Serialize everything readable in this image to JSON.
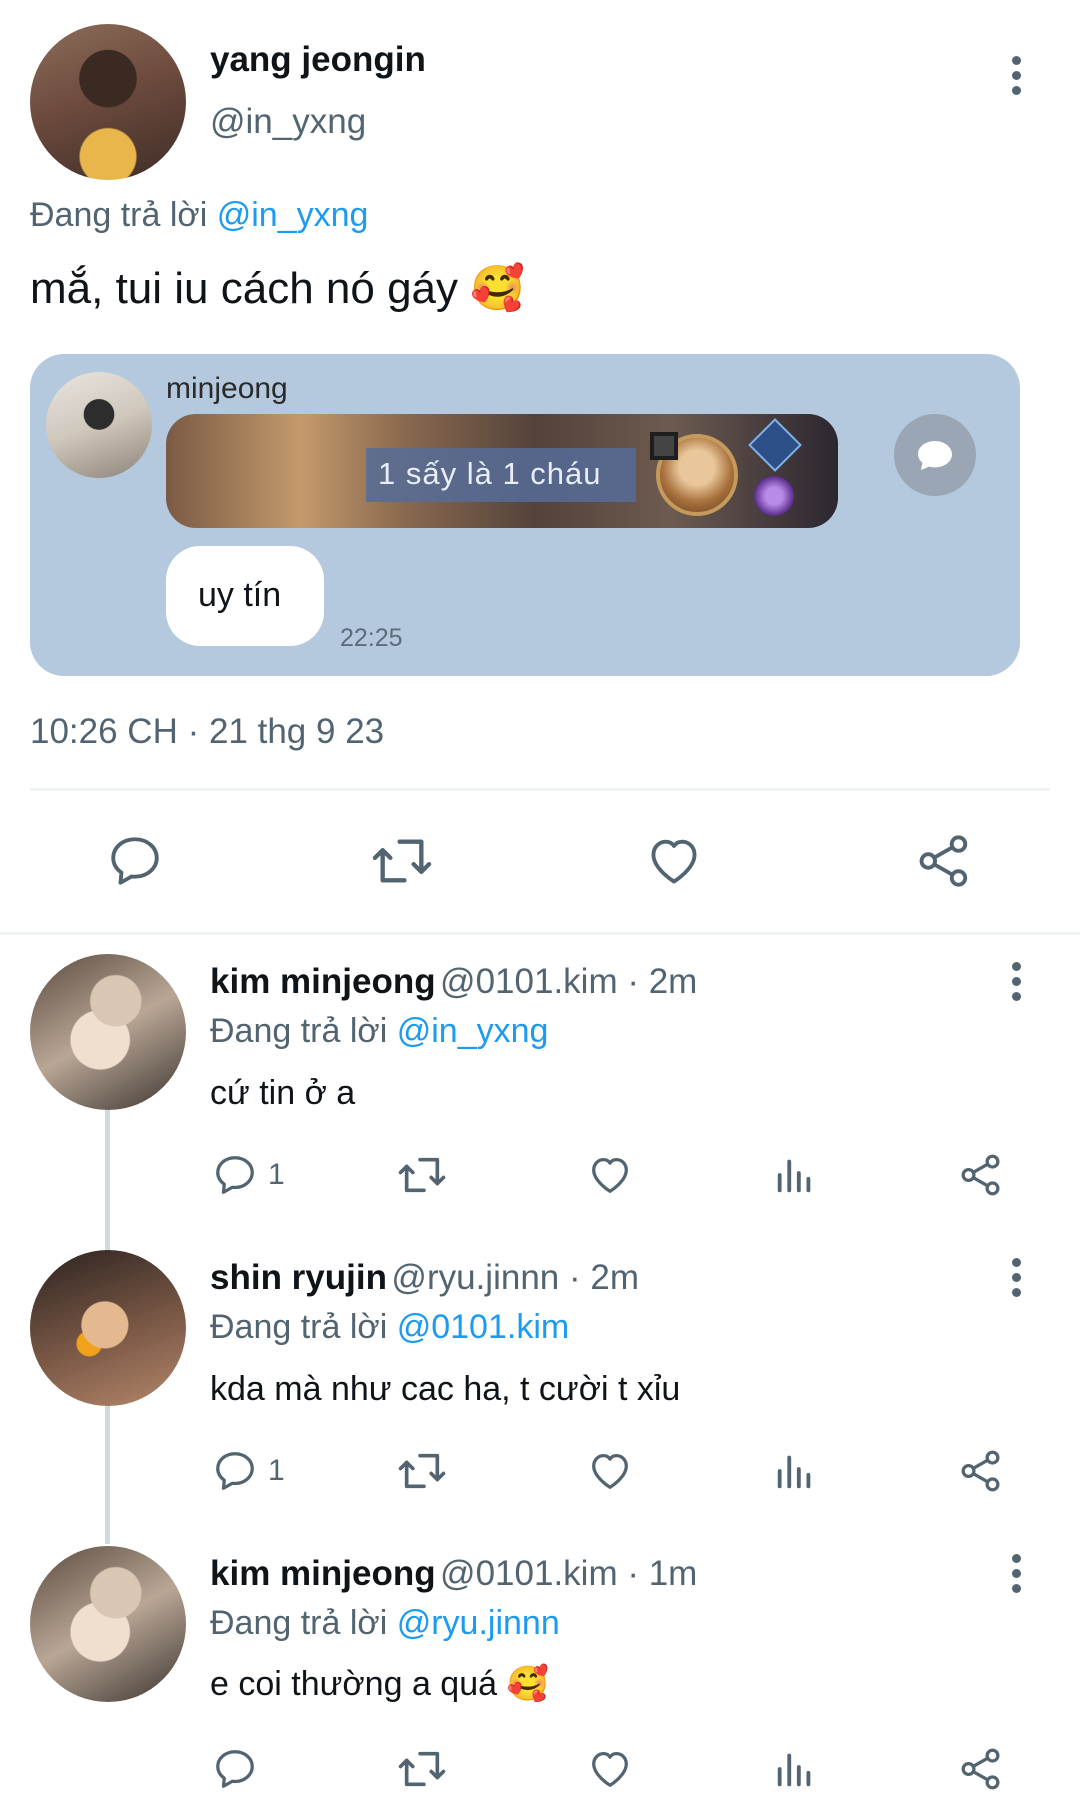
{
  "main_tweet": {
    "display_name": "yang jeongin",
    "handle": "@in_yxng",
    "reply_prefix": "Đang trả lời",
    "reply_mention": "@in_yxng",
    "text": "mắ, tui iu cách nó gáy 🥰",
    "timestamp": "10:26 CH · 21 thg 9 23",
    "embedded_message": {
      "sender": "minjeong",
      "game_caption": "1 sấy là 1 cháu",
      "bubble_text": "uy tín",
      "time": "22:25"
    },
    "action_icons": [
      "reply-icon",
      "retweet-icon",
      "like-icon",
      "share-icon"
    ]
  },
  "replies": [
    {
      "display_name": "kim minjeong",
      "handle_time": "@0101.kim · 2m",
      "reply_prefix": "Đang trả lời",
      "reply_mention": "@in_yxng",
      "text": "cứ tin ở a",
      "reply_count": "1"
    },
    {
      "display_name": "shin ryujin",
      "handle_time": "@ryu.jinnn · 2m",
      "reply_prefix": "Đang trả lời",
      "reply_mention": "@0101.kim",
      "text": "kda mà như cac ha, t cười t xỉu",
      "reply_count": "1"
    },
    {
      "display_name": "kim minjeong",
      "handle_time": "@0101.kim · 1m",
      "reply_prefix": "Đang trả lời",
      "reply_mention": "@ryu.jinnn",
      "text": "e coi thường a quá 🥰",
      "reply_count": ""
    }
  ],
  "colors": {
    "text": "#0f1419",
    "secondary": "#536471",
    "mention": "#1d9bf0",
    "card_bg": "#b4c8de",
    "divider": "#eff3f4"
  }
}
